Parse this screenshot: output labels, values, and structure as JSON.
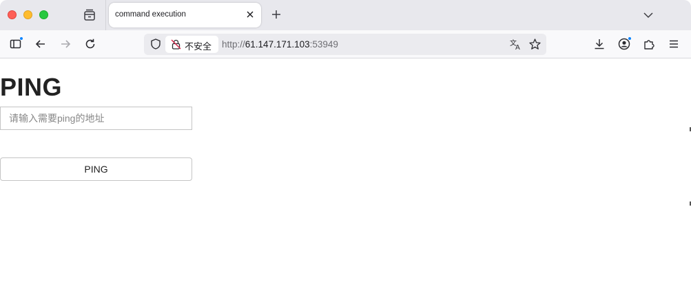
{
  "browser": {
    "tab": {
      "title": "command execution"
    },
    "urlbar": {
      "security_label": "不安全",
      "url_scheme": "http://",
      "url_host": "61.147.171.103",
      "url_port": ":53949"
    }
  },
  "page": {
    "title": "PING",
    "input": {
      "placeholder": "请输入需要ping的地址",
      "value": ""
    },
    "submit_label": "PING"
  },
  "colors": {
    "accent": "#0a84ff",
    "insecure": "#d7264c",
    "window_close": "#fe5f57",
    "window_minimize": "#febc2e",
    "window_maximize": "#28c840"
  },
  "icons": [
    "tab-list-icon",
    "close-icon",
    "plus-icon",
    "chevron-down-icon",
    "sidebar-icon",
    "back-arrow-icon",
    "forward-arrow-icon",
    "reload-icon",
    "shield-icon",
    "insecure-lock-icon",
    "translate-icon",
    "star-icon",
    "download-icon",
    "account-icon",
    "extensions-icon",
    "menu-icon"
  ]
}
